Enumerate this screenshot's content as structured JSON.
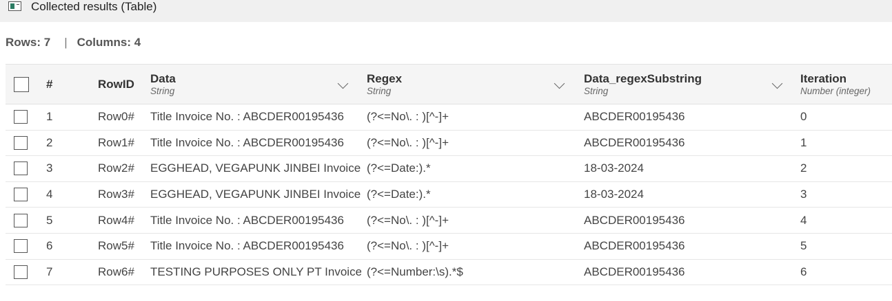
{
  "window": {
    "title": "Collected results (Table)",
    "icon": "table-window-icon"
  },
  "summary": {
    "rows": "Rows: 7",
    "separator": "|",
    "columns": "Columns: 4"
  },
  "table": {
    "header": {
      "num": "#",
      "rowid": "RowID",
      "columns": [
        {
          "name": "Data",
          "type": "String"
        },
        {
          "name": "Regex",
          "type": "String"
        },
        {
          "name": "Data_regexSubstring",
          "type": "String"
        },
        {
          "name": "Iteration",
          "type": "Number (integer)"
        }
      ]
    },
    "rows": [
      {
        "num": "1",
        "rowid": "Row0#",
        "data": "Title Invoice No. : ABCDER00195436",
        "regex": "(?<=No\\. : )[^-]+",
        "sub": "ABCDER00195436",
        "iter": "0"
      },
      {
        "num": "2",
        "rowid": "Row1#",
        "data": "Title Invoice No. : ABCDER00195436",
        "regex": "(?<=No\\. : )[^-]+",
        "sub": "ABCDER00195436",
        "iter": "1"
      },
      {
        "num": "3",
        "rowid": "Row2#",
        "data": "EGGHEAD, VEGAPUNK JINBEI Invoice",
        "regex": "(?<=Date:).*",
        "sub": "18-03-2024",
        "iter": "2"
      },
      {
        "num": "4",
        "rowid": "Row3#",
        "data": "EGGHEAD, VEGAPUNK JINBEI Invoice",
        "regex": "(?<=Date:).*",
        "sub": "18-03-2024",
        "iter": "3"
      },
      {
        "num": "5",
        "rowid": "Row4#",
        "data": "Title Invoice No. : ABCDER00195436",
        "regex": "(?<=No\\. : )[^-]+",
        "sub": "ABCDER00195436",
        "iter": "4"
      },
      {
        "num": "6",
        "rowid": "Row5#",
        "data": "Title Invoice No. : ABCDER00195436",
        "regex": "(?<=No\\. : )[^-]+",
        "sub": "ABCDER00195436",
        "iter": "5"
      },
      {
        "num": "7",
        "rowid": "Row6#",
        "data": "TESTING PURPOSES ONLY PT Invoice",
        "regex": "(?<=Number:\\s).*$",
        "sub": "ABCDER00195436",
        "iter": "6"
      }
    ]
  }
}
